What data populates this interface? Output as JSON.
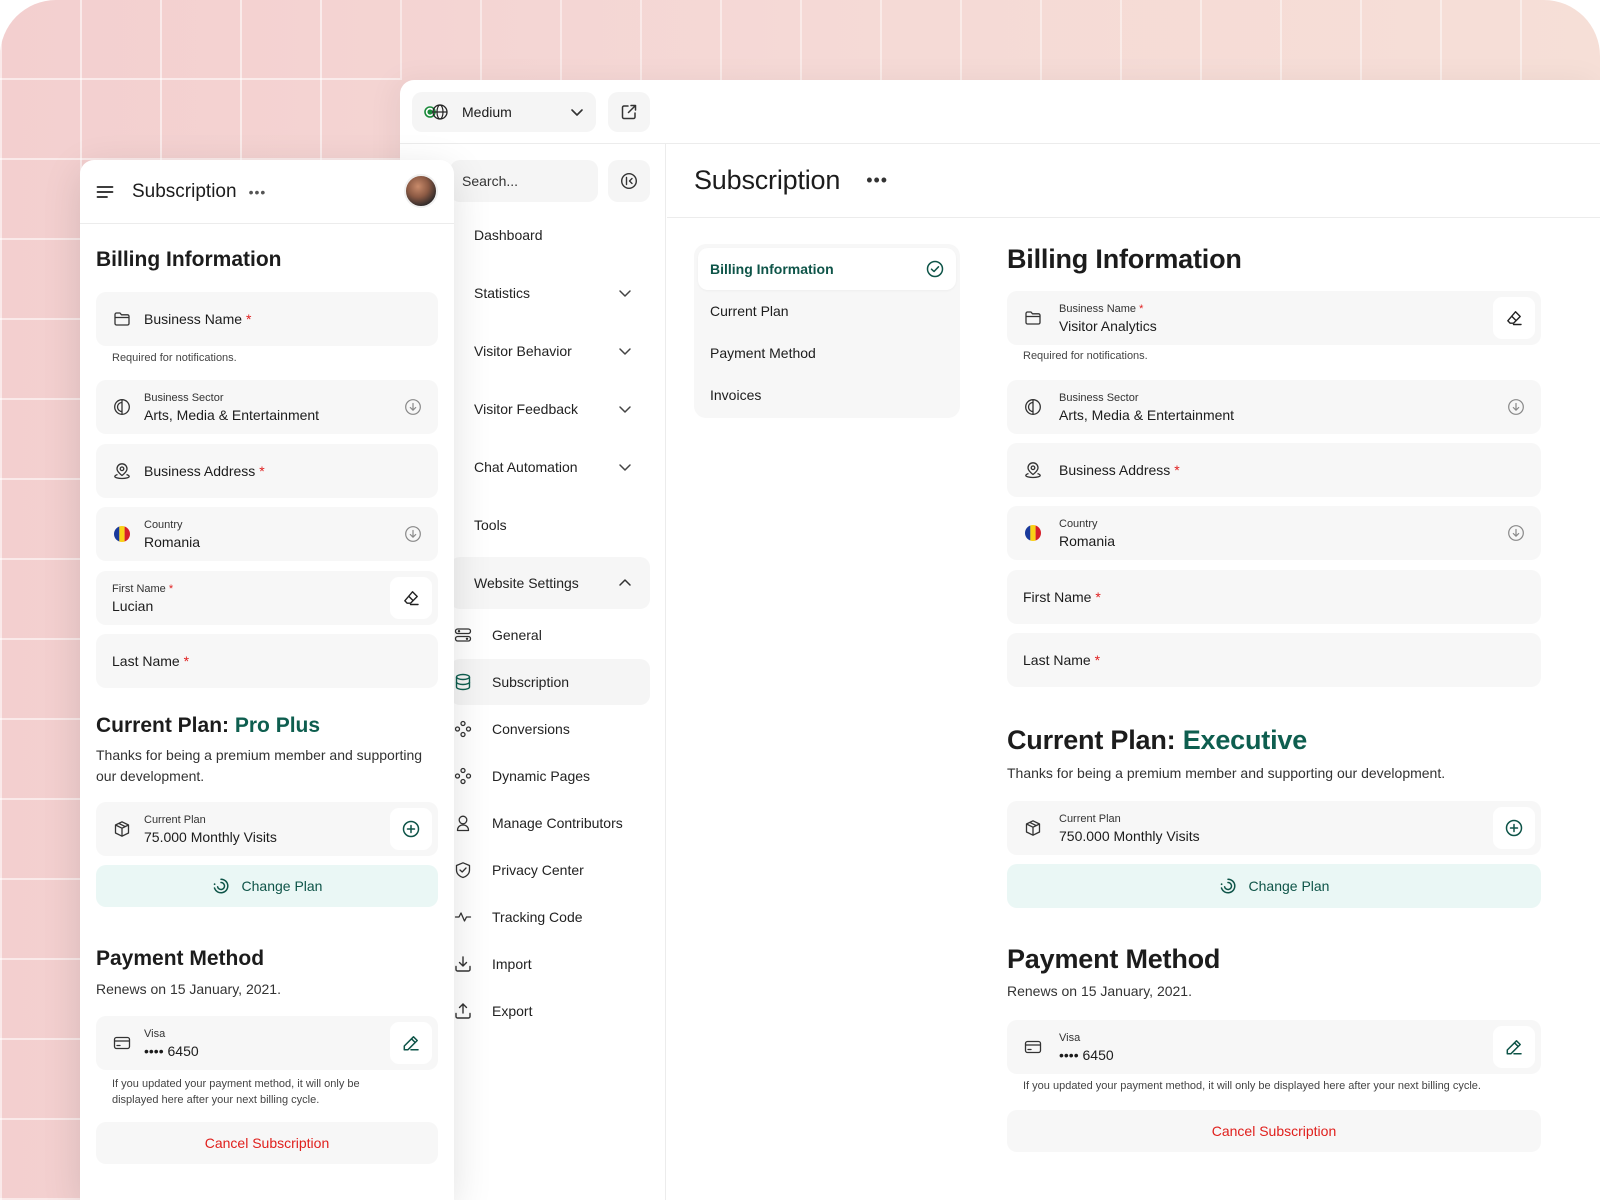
{
  "desktop": {
    "site_select": {
      "label": "Medium"
    },
    "search": {
      "placeholder": "Search..."
    },
    "nav": [
      {
        "label": "Dashboard"
      },
      {
        "label": "Statistics"
      },
      {
        "label": "Visitor Behavior"
      },
      {
        "label": "Visitor Feedback"
      },
      {
        "label": "Chat Automation"
      },
      {
        "label": "Tools"
      },
      {
        "label": "Website Settings"
      }
    ],
    "sub_nav": [
      {
        "label": "General"
      },
      {
        "label": "Subscription"
      },
      {
        "label": "Conversions"
      },
      {
        "label": "Dynamic Pages"
      },
      {
        "label": "Manage Contributors"
      },
      {
        "label": "Privacy Center"
      },
      {
        "label": "Tracking Code"
      },
      {
        "label": "Import"
      },
      {
        "label": "Export"
      }
    ],
    "page_title": "Subscription",
    "page_dots": "•••",
    "section_nav": [
      {
        "label": "Billing Information"
      },
      {
        "label": "Current Plan"
      },
      {
        "label": "Payment Method"
      },
      {
        "label": "Invoices"
      }
    ],
    "billing": {
      "heading": "Billing Information",
      "business_name_label": "Business Name",
      "business_name_value": "Visitor Analytics",
      "business_name_hint": "Required for notifications.",
      "sector_label": "Business Sector",
      "sector_value": "Arts, Media & Entertainment",
      "address_label": "Business Address",
      "country_label": "Country",
      "country_value": "Romania",
      "first_name_label": "First Name",
      "last_name_label": "Last Name",
      "required_mark": "*"
    },
    "plan": {
      "heading_prefix": "Current Plan:",
      "heading_plan": "Executive",
      "description": "Thanks for being a premium member and supporting our development.",
      "field_label": "Current Plan",
      "field_value": "750.000 Monthly Visits",
      "change_label": "Change Plan"
    },
    "payment": {
      "heading": "Payment Method",
      "renews_prefix": "Renews on ",
      "renews_date": "15 January, 2021.",
      "card_label": "Visa",
      "card_value": "•••• 6450",
      "hint": "If you updated your payment method, it will only be displayed here after your next billing cycle.",
      "cancel_label": "Cancel Subscription"
    }
  },
  "mobile": {
    "title": "Subscription",
    "dots": "•••",
    "billing": {
      "heading": "Billing Information",
      "business_name_label": "Business Name",
      "business_name_hint": "Required for notifications.",
      "sector_label": "Business Sector",
      "sector_value": "Arts, Media & Entertainment",
      "address_label": "Business Address",
      "country_label": "Country",
      "country_value": "Romania",
      "first_name_label": "First Name",
      "first_name_value": "Lucian",
      "last_name_label": "Last Name",
      "required_mark": "*"
    },
    "plan": {
      "heading_prefix": "Current Plan:",
      "heading_plan": "Pro Plus",
      "description": "Thanks for being a premium member and supporting our development.",
      "field_label": "Current Plan",
      "field_value": "75.000 Monthly Visits",
      "change_label": "Change Plan"
    },
    "payment": {
      "heading": "Payment Method",
      "renews_prefix": "Renews on ",
      "renews_date": "15 January, 2021.",
      "card_label": "Visa",
      "card_value": "•••• 6450",
      "hint": "If you updated your payment method, it will only be displayed here after your next billing cycle.",
      "cancel_label": "Cancel Subscription"
    }
  },
  "colors": {
    "accent_green": "#0e5e4f",
    "change_plan_bg": "#eaf7f5",
    "danger_red": "#e0201d",
    "background_pink": "#f3cfcf"
  }
}
